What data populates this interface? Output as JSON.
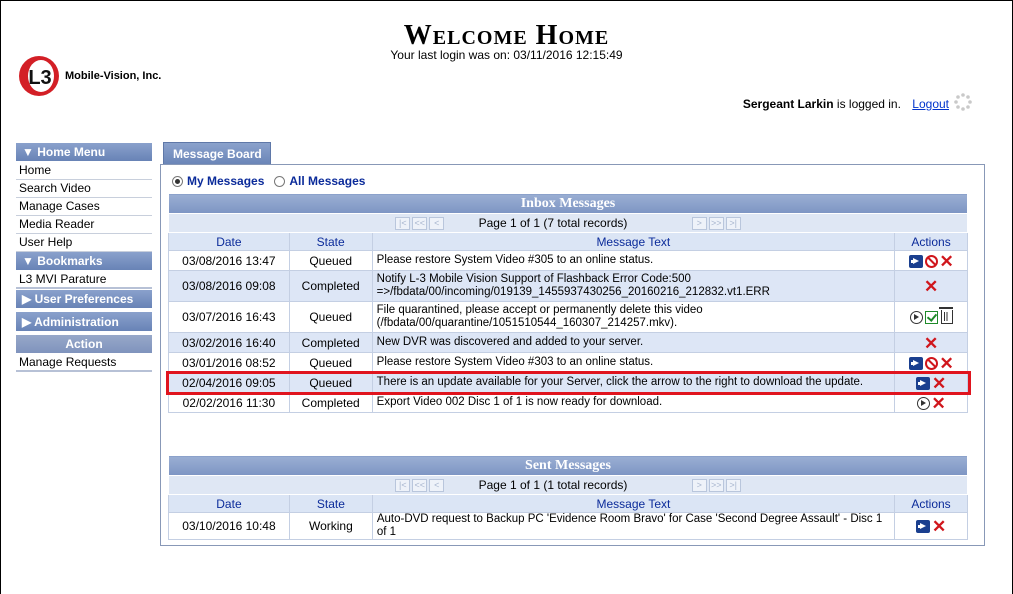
{
  "header": {
    "company": "Mobile-Vision, Inc.",
    "logo_mark": "L3",
    "title": "Welcome Home",
    "last_login": "Your last login was on: 03/11/2016 12:15:49",
    "user_name": "Sergeant Larkin",
    "logged_in_text": " is logged in.",
    "logout_label": "Logout"
  },
  "menu": {
    "home_menu": "▼ Home Menu",
    "home_items": [
      "Home",
      "Search Video",
      "Manage Cases",
      "Media Reader",
      "User Help"
    ],
    "bookmarks": "▼ Bookmarks",
    "bookmark_items": [
      "L3 MVI Parature"
    ],
    "user_prefs": "▶ User Preferences",
    "administration": "▶ Administration",
    "action": "Action",
    "action_items": [
      "Manage Requests"
    ]
  },
  "board": {
    "tab_label": "Message Board",
    "my_messages": "My Messages",
    "all_messages": "All Messages",
    "selected_filter": "My Messages"
  },
  "inbox": {
    "title": "Inbox Messages",
    "pager_text": "Page 1 of 1 (7 total records)",
    "columns": [
      "Date",
      "State",
      "Message Text",
      "Actions"
    ],
    "rows": [
      {
        "date": "03/08/2016 13:47",
        "state": "Queued",
        "text": "Please restore System Video #305 to an online status.",
        "actions": [
          "arrow",
          "block",
          "x"
        ]
      },
      {
        "date": "03/08/2016 09:08",
        "state": "Completed",
        "text": "Notify L-3 Mobile Vision Support of Flashback Error Code:500 =>/fbdata/00/incoming/019139_1455937430256_20160216_212832.vt1.ERR",
        "actions": [
          "x"
        ]
      },
      {
        "date": "03/07/2016 16:43",
        "state": "Queued",
        "text": "File quarantined, please accept or permanently delete this video (/fbdata/00/quarantine/1051510544_160307_214257.mkv).",
        "actions": [
          "play",
          "check",
          "trash"
        ]
      },
      {
        "date": "03/02/2016 16:40",
        "state": "Completed",
        "text": "New DVR was discovered and added to your server.",
        "actions": [
          "x"
        ]
      },
      {
        "date": "03/01/2016 08:52",
        "state": "Queued",
        "text": "Please restore System Video #303 to an online status.",
        "actions": [
          "arrow",
          "block",
          "x"
        ]
      },
      {
        "date": "02/04/2016 09:05",
        "state": "Queued",
        "text": "There is an update available for your Server, click the arrow to the right to download the update.",
        "actions": [
          "arrow",
          "x"
        ]
      },
      {
        "date": "02/02/2016 11:30",
        "state": "Completed",
        "text": "Export Video 002 Disc 1 of 1 is now ready for download.",
        "actions": [
          "play",
          "x"
        ]
      }
    ]
  },
  "sent": {
    "title": "Sent Messages",
    "pager_text": "Page 1 of 1 (1 total records)",
    "columns": [
      "Date",
      "State",
      "Message Text",
      "Actions"
    ],
    "rows": [
      {
        "date": "03/10/2016 10:48",
        "state": "Working",
        "text": "Auto-DVD request to Backup PC 'Evidence Room Bravo' for Case 'Second Degree Assault' - Disc 1 of 1",
        "actions": [
          "arrow",
          "x"
        ]
      }
    ]
  },
  "colors": {
    "highlight": "#e0141e",
    "menu_header": "#7b93bf",
    "link": "#0033cc"
  }
}
